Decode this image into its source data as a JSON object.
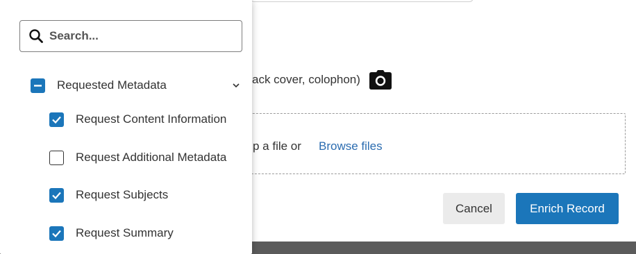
{
  "instruction": {
    "text_fragment": "ack cover, colophon)"
  },
  "icons": {
    "camera": "camera-icon",
    "search": "search-icon",
    "chevron": "chevron-down-icon"
  },
  "upload": {
    "drop_text_fragment": "p a file or",
    "browse_label": "Browse files"
  },
  "actions": {
    "cancel_label": "Cancel",
    "enrich_label": "Enrich Record"
  },
  "dropdown": {
    "search": {
      "placeholder": "Search...",
      "value": ""
    },
    "group": {
      "label": "Requested Metadata",
      "state": "indeterminate"
    },
    "options": [
      {
        "label": "Request Content Information",
        "checked": true
      },
      {
        "label": "Request Additional Metadata",
        "checked": false
      },
      {
        "label": "Request Subjects",
        "checked": true
      },
      {
        "label": "Request Summary",
        "checked": true
      }
    ]
  },
  "colors": {
    "accent": "#1b76ba",
    "link": "#2b6cb0",
    "cancel_bg": "#ebebeb"
  }
}
